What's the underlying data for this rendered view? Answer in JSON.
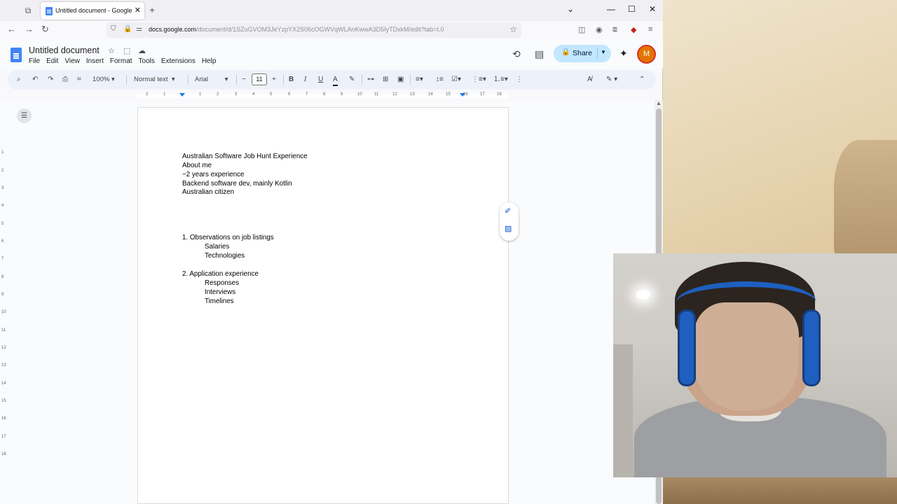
{
  "browser": {
    "tab_title": "Untitled document - Google Do",
    "url_host": "docs.google.com",
    "url_path": "/document/d/1SZuGVOM3JeYzpYX2S06cOGWVqWLAnKwwA3D5IyTDxkM/edit?tab=t.0"
  },
  "docs": {
    "title": "Untitled document",
    "menu": [
      "File",
      "Edit",
      "View",
      "Insert",
      "Format",
      "Tools",
      "Extensions",
      "Help"
    ],
    "share_label": "Share",
    "avatar_letter": "M",
    "toolbar": {
      "zoom": "100%",
      "style": "Normal text",
      "font": "Arial",
      "font_size": "11"
    },
    "ruler_ticks": [
      "2",
      "1",
      "1",
      "2",
      "3",
      "4",
      "5",
      "6",
      "7",
      "8",
      "9",
      "10",
      "11",
      "12",
      "13",
      "14",
      "15",
      "16",
      "17",
      "18"
    ],
    "vruler_ticks": [
      "1",
      "2",
      "3",
      "4",
      "5",
      "6",
      "7",
      "8",
      "9",
      "10",
      "11",
      "12",
      "13",
      "14",
      "15",
      "16",
      "17",
      "18"
    ]
  },
  "document": {
    "lines": [
      "Australian Software Job Hunt Experience",
      "About me",
      "~2 years experience",
      "Backend software dev, mainly Kotlin",
      "Australian citizen"
    ],
    "list1": "1. Observations on job listings",
    "list1_sub": [
      "Salaries",
      "Technologies"
    ],
    "list2": "2. Application experience",
    "list2_sub": [
      "Responses",
      "Interviews",
      "Timelines"
    ]
  },
  "colors": {
    "share_bg": "#c2e7ff",
    "toolbar_bg": "#edf2fa",
    "docs_blue": "#4285f4",
    "avatar": "#e37400"
  }
}
